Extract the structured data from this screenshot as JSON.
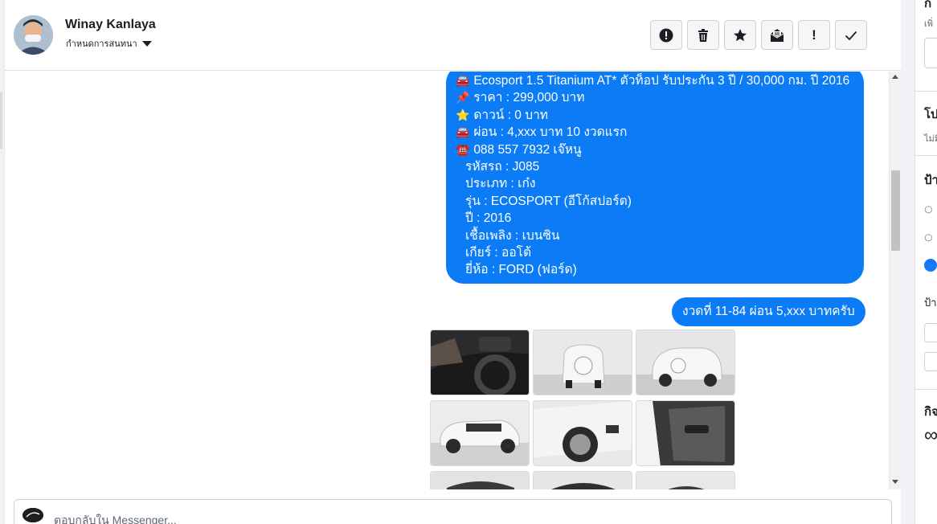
{
  "contact": {
    "name": "Winay Kanlaya",
    "assign_label": "กำหนดการสนทนา"
  },
  "toolbar": {
    "spam_icon": "exclamation-circle-icon",
    "delete_icon": "trash-icon",
    "star_icon": "star-icon",
    "mark_unread_icon": "envelope-open-icon",
    "follow_up_label": "!",
    "done_icon": "check-icon"
  },
  "messages": {
    "bubble1_lines": [
      {
        "emoji": "🚘",
        "text": "Ecosport 1.5 Titanium AT* ตัวท็อป รับประกัน 3 ปี / 30,000 กม. ปี 2016"
      },
      {
        "emoji": "📌",
        "text": "ราคา : 299,000 บาท"
      },
      {
        "emoji": "⭐",
        "text": "ดาวน์ : 0 บาท"
      },
      {
        "emoji": "🚘",
        "text": "ผ่อน : 4,xxx บาท 10 งวดแรก"
      },
      {
        "emoji": "☎️",
        "text": "088 557 7932 เจ๊หนู"
      },
      {
        "emoji": "",
        "text": "รหัสรถ : J085"
      },
      {
        "emoji": "",
        "text": "ประเภท : เก๋ง"
      },
      {
        "emoji": "",
        "text": "รุ่น : ECOSPORT (อีโก้สปอร์ต)"
      },
      {
        "emoji": "",
        "text": "ปี : 2016"
      },
      {
        "emoji": "",
        "text": "เชื้อเพลิง : เบนซิน"
      },
      {
        "emoji": "",
        "text": "เกียร์ : ออโต้"
      },
      {
        "emoji": "",
        "text": "ยี่ห้อ : FORD (ฟอร์ด)"
      }
    ],
    "bubble2_text": "งวดที่ 11-84 ผ่อน 5,xxx บาทครับ",
    "photos": [
      "car-interior-dashboard",
      "car-rear-white",
      "car-rear-three-quarter",
      "car-side-white",
      "car-front-wheel",
      "car-door-interior",
      "car-photo-7",
      "car-photo-8",
      "car-photo-9"
    ]
  },
  "composer": {
    "placeholder": "ตอบกลับใน Messenger..."
  },
  "right_panel": {
    "h1": "ก",
    "s1": "เพิ่",
    "h2": "โป",
    "s2": "ไม่มี",
    "h3": "ป้า",
    "s3": "ป้า",
    "h4": "กิจ",
    "glyph": "∞"
  },
  "colors": {
    "bubble": "#0b7bf6",
    "background": "#f0f2f5"
  }
}
